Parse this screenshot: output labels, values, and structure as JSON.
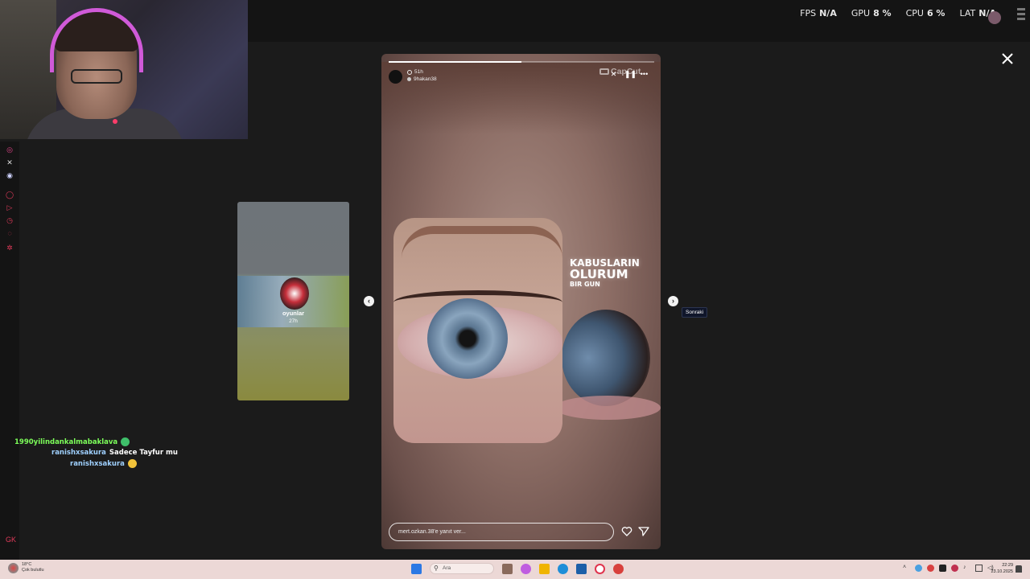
{
  "perf": {
    "fps_label": "FPS",
    "fps_value": "N/A",
    "gpu_label": "GPU",
    "gpu_value": "8 %",
    "cpu_label": "CPU",
    "cpu_value": "6 %",
    "lat_label": "LAT",
    "lat_value": "N/A"
  },
  "chat": [
    {
      "user": "1990yilindankalmabaklava",
      "text": "",
      "user_color": "#7dff5a",
      "emote": "green-emote"
    },
    {
      "user": "ranishxsakura",
      "text": "Sadece Tayfur mu",
      "user_color": "#9fd0ff"
    },
    {
      "user": "ranishxsakura",
      "text": "",
      "user_color": "#9fd0ff",
      "emote": "yellow-emoji"
    }
  ],
  "prev_story": {
    "username": "oyunlar",
    "time": "27h"
  },
  "story": {
    "time": "51h",
    "username": "9hakan38",
    "progress_fraction": 0.5,
    "watermark": "CapCut",
    "headline_line1": "KABUSLARIN",
    "headline_line2": "OLURUM",
    "headline_line3": "BIR GUN",
    "reply_placeholder": "mert.ozkan.38'e yanıt ver..."
  },
  "tooltip_next": "Sonraki",
  "taskbar": {
    "weather_temp": "18°C",
    "weather_desc": "Çok bulutlu",
    "search_placeholder": "Ara",
    "time": "22:29",
    "date": "23.10.2025"
  },
  "colors": {
    "accent": "#e03a5a",
    "background": "#1b1b1b",
    "taskbar": "#ecd8d6"
  }
}
